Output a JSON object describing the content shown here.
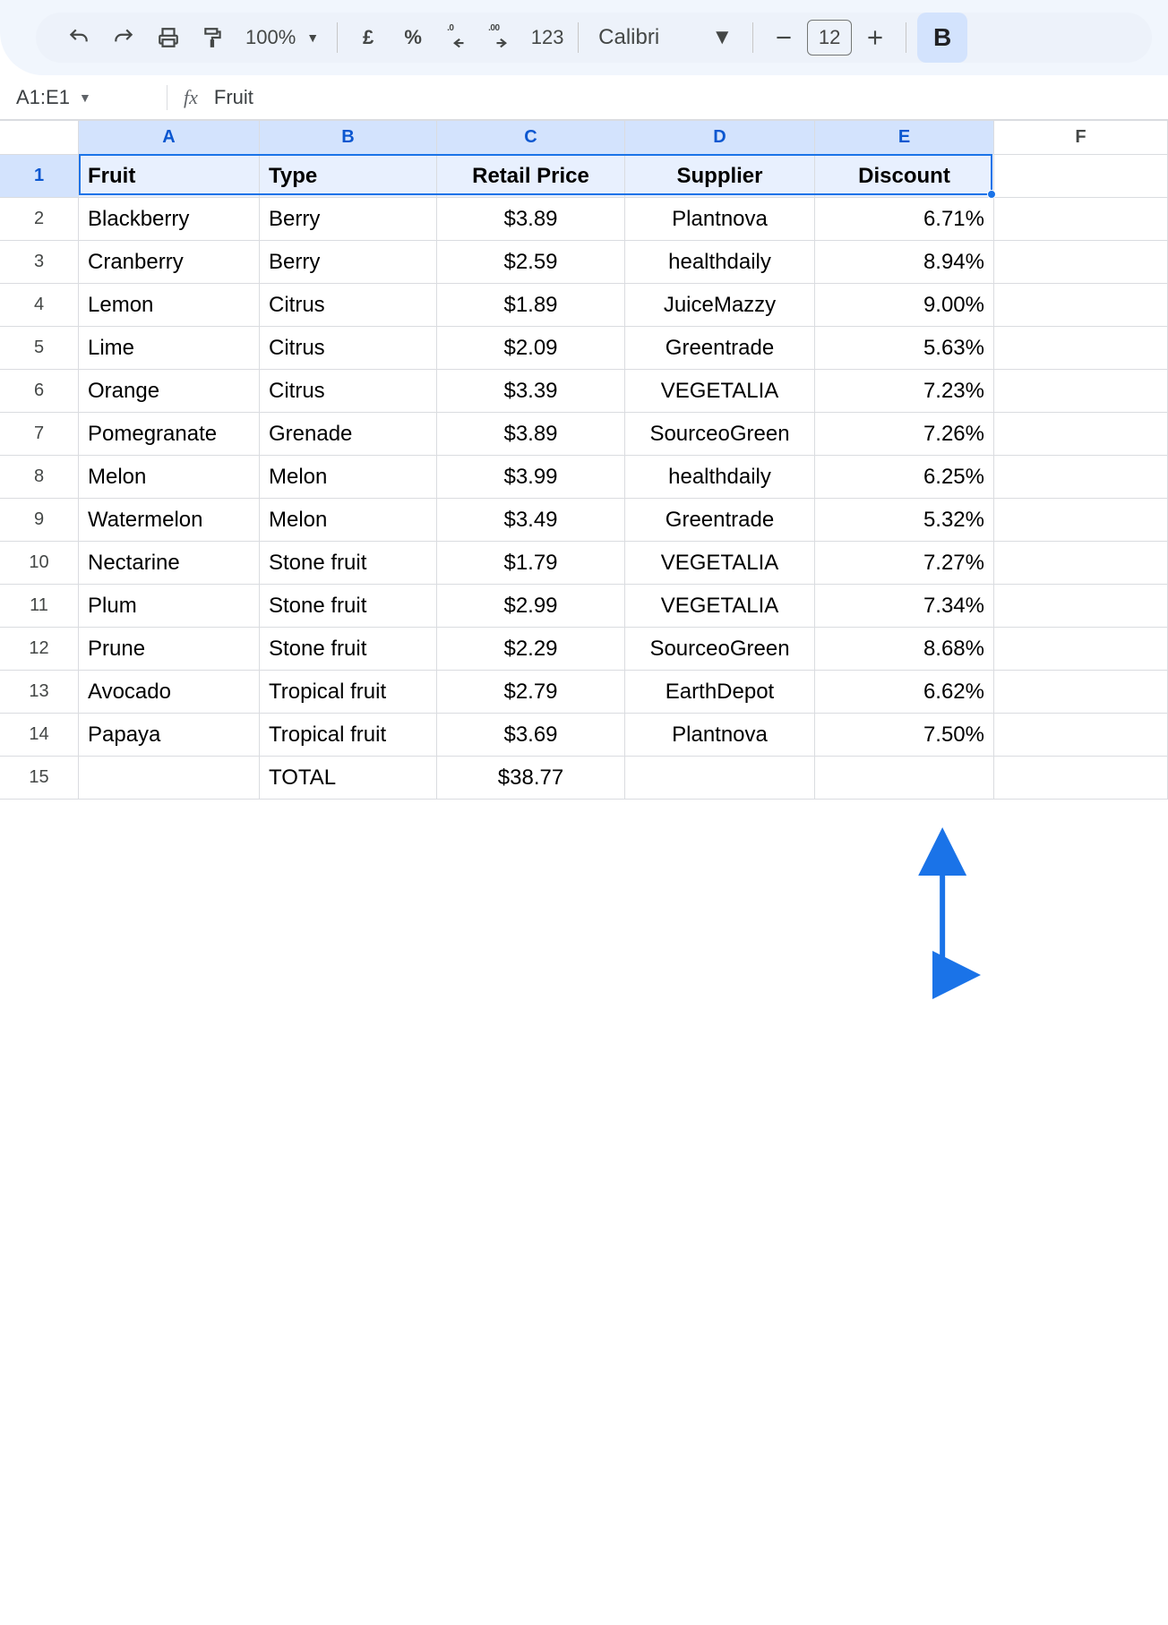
{
  "toolbar": {
    "zoom": "100%",
    "currency_symbol": "£",
    "percent_symbol": "%",
    "decrease_decimal_label": ".0",
    "increase_decimal_label": ".00",
    "more_formats_label": "123",
    "font_name": "Calibri",
    "font_size": "12",
    "bold_label": "B"
  },
  "namebox": {
    "ref": "A1:E1"
  },
  "formula": {
    "fx_label": "fx",
    "value": "Fruit"
  },
  "columns": [
    "A",
    "B",
    "C",
    "D",
    "E",
    "F"
  ],
  "selected_columns": [
    "A",
    "B",
    "C",
    "D",
    "E"
  ],
  "selected_rows": [
    1
  ],
  "headers": {
    "fruit": "Fruit",
    "type": "Type",
    "price": "Retail Price",
    "supplier": "Supplier",
    "discount": "Discount"
  },
  "rows": [
    {
      "n": 2,
      "fruit": "Blackberry",
      "type": "Berry",
      "price": "$3.89",
      "supplier": "Plantnova",
      "discount": "6.71%"
    },
    {
      "n": 3,
      "fruit": "Cranberry",
      "type": "Berry",
      "price": "$2.59",
      "supplier": "healthdaily",
      "discount": "8.94%"
    },
    {
      "n": 4,
      "fruit": "Lemon",
      "type": "Citrus",
      "price": "$1.89",
      "supplier": "JuiceMazzy",
      "discount": "9.00%"
    },
    {
      "n": 5,
      "fruit": "Lime",
      "type": "Citrus",
      "price": "$2.09",
      "supplier": "Greentrade",
      "discount": "5.63%"
    },
    {
      "n": 6,
      "fruit": "Orange",
      "type": "Citrus",
      "price": "$3.39",
      "supplier": "VEGETALIA",
      "discount": "7.23%"
    },
    {
      "n": 7,
      "fruit": "Pomegranate",
      "type": "Grenade",
      "price": "$3.89",
      "supplier": "SourceoGreen",
      "discount": "7.26%"
    },
    {
      "n": 8,
      "fruit": "Melon",
      "type": "Melon",
      "price": "$3.99",
      "supplier": "healthdaily",
      "discount": "6.25%"
    },
    {
      "n": 9,
      "fruit": "Watermelon",
      "type": "Melon",
      "price": "$3.49",
      "supplier": "Greentrade",
      "discount": "5.32%"
    },
    {
      "n": 10,
      "fruit": "Nectarine",
      "type": "Stone fruit",
      "price": "$1.79",
      "supplier": "VEGETALIA",
      "discount": "7.27%"
    },
    {
      "n": 11,
      "fruit": "Plum",
      "type": "Stone fruit",
      "price": "$2.99",
      "supplier": "VEGETALIA",
      "discount": "7.34%"
    },
    {
      "n": 12,
      "fruit": "Prune",
      "type": "Stone fruit",
      "price": "$2.29",
      "supplier": "SourceoGreen",
      "discount": "8.68%"
    },
    {
      "n": 13,
      "fruit": "Avocado",
      "type": "Tropical fruit",
      "price": "$2.79",
      "supplier": "EarthDepot",
      "discount": "6.62%"
    },
    {
      "n": 14,
      "fruit": "Papaya",
      "type": "Tropical fruit",
      "price": "$3.69",
      "supplier": "Plantnova",
      "discount": "7.50%"
    }
  ],
  "total_row": {
    "n": 15,
    "label": "TOTAL",
    "value": "$38.77"
  },
  "chart_data": {
    "type": "table",
    "columns": [
      "Fruit",
      "Type",
      "Retail Price",
      "Supplier",
      "Discount"
    ],
    "rows": [
      [
        "Blackberry",
        "Berry",
        3.89,
        "Plantnova",
        6.71
      ],
      [
        "Cranberry",
        "Berry",
        2.59,
        "healthdaily",
        8.94
      ],
      [
        "Lemon",
        "Citrus",
        1.89,
        "JuiceMazzy",
        9.0
      ],
      [
        "Lime",
        "Citrus",
        2.09,
        "Greentrade",
        5.63
      ],
      [
        "Orange",
        "Citrus",
        3.39,
        "VEGETALIA",
        7.23
      ],
      [
        "Pomegranate",
        "Grenade",
        3.89,
        "SourceoGreen",
        7.26
      ],
      [
        "Melon",
        "Melon",
        3.99,
        "healthdaily",
        6.25
      ],
      [
        "Watermelon",
        "Melon",
        3.49,
        "Greentrade",
        5.32
      ],
      [
        "Nectarine",
        "Stone fruit",
        1.79,
        "VEGETALIA",
        7.27
      ],
      [
        "Plum",
        "Stone fruit",
        2.99,
        "VEGETALIA",
        7.34
      ],
      [
        "Prune",
        "Stone fruit",
        2.29,
        "SourceoGreen",
        8.68
      ],
      [
        "Avocado",
        "Tropical fruit",
        2.79,
        "EarthDepot",
        6.62
      ],
      [
        "Papaya",
        "Tropical fruit",
        3.69,
        "Plantnova",
        7.5
      ]
    ],
    "total": 38.77
  }
}
